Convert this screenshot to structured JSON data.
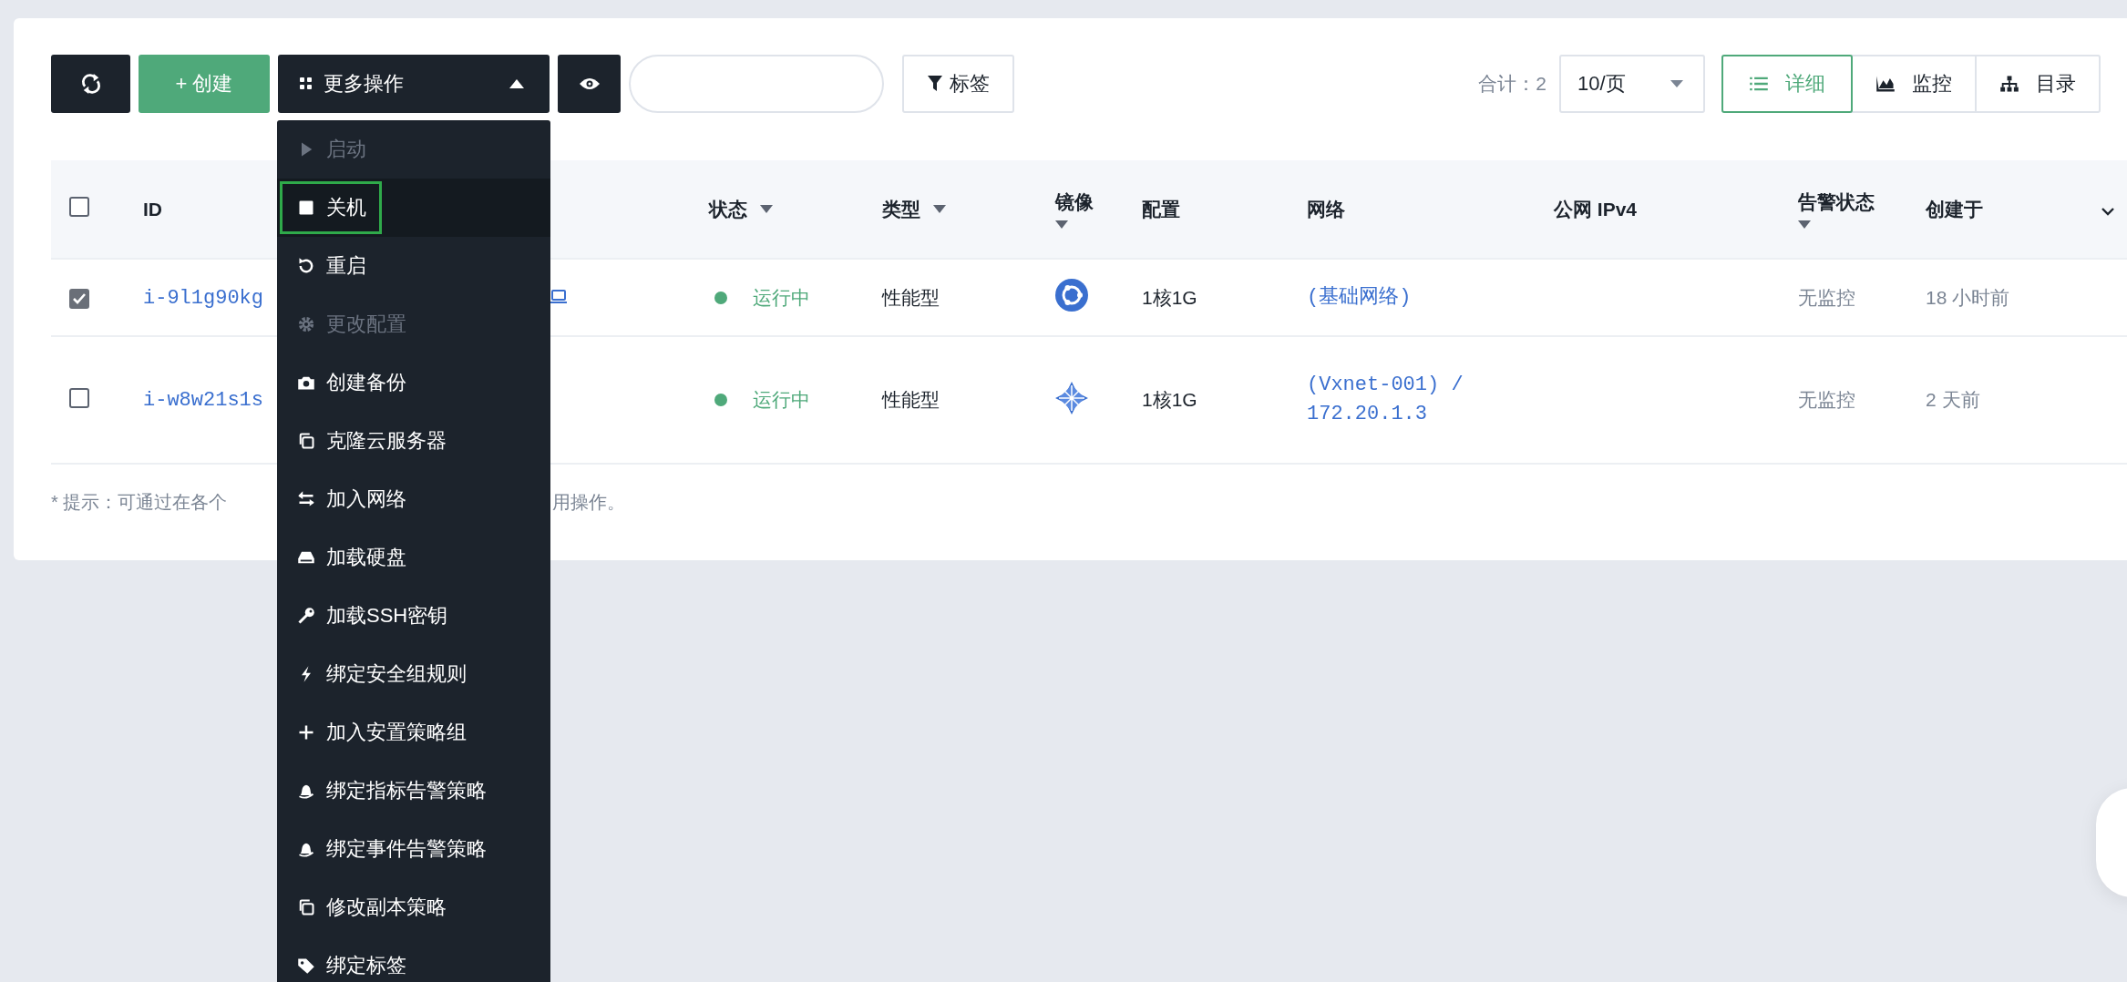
{
  "toolbar": {
    "create_button": "+ 创建",
    "more_button": {
      "label": "更多操作",
      "expanded": true
    },
    "tag_button": "标签",
    "total": "合计：2",
    "page_size": "10/页",
    "views": [
      {
        "label": "详细",
        "kind": "list",
        "selected": true
      },
      {
        "label": "监控",
        "kind": "area",
        "selected": false
      },
      {
        "label": "目录",
        "kind": "tree",
        "selected": false
      }
    ]
  },
  "table": {
    "select_all": {
      "checked": false
    },
    "columns": [
      {
        "label": "ID",
        "filter": false
      },
      {
        "label": "状态",
        "filter": true
      },
      {
        "label": "类型",
        "filter": true
      },
      {
        "label": "镜像",
        "filter": true
      },
      {
        "label": "配置",
        "filter": false
      },
      {
        "label": "网络",
        "filter": false
      },
      {
        "label": "公网 IPv4",
        "filter": false
      },
      {
        "label": "告警状态",
        "filter": true
      },
      {
        "label": "创建于",
        "filter": false
      }
    ],
    "rows": [
      {
        "checked": true,
        "id": "i-9l1g90kg",
        "console_icon": true,
        "status": "运行中",
        "type": "性能型",
        "image": {
          "kind": "ring"
        },
        "config": "1核1G",
        "network": "(基础网络)",
        "alarm": "无监控",
        "created": "18 小时前"
      },
      {
        "checked": false,
        "id": "i-w8w21s1s",
        "console_icon": false,
        "status": "运行中",
        "type": "性能型",
        "image": {
          "kind": "flake"
        },
        "config": "1核1G",
        "network": "(Vxnet-001) / 172.20.1.3",
        "alarm": "无监控",
        "created": "2 天前"
      }
    ]
  },
  "hint": [
    "* 提示：可通过在各个",
    "用操作。"
  ],
  "menu": {
    "items": [
      {
        "label": "启动",
        "kind": "play",
        "disabled": true,
        "selected": false
      },
      {
        "label": "关机",
        "kind": "stop",
        "disabled": false,
        "selected": true
      },
      {
        "label": "重启",
        "kind": "restart",
        "disabled": false,
        "selected": false
      },
      {
        "label": "更改配置",
        "kind": "gear",
        "disabled": true,
        "selected": false
      },
      {
        "label": "创建备份",
        "kind": "camera",
        "disabled": false,
        "selected": false
      },
      {
        "label": "克隆云服务器",
        "kind": "copy",
        "disabled": false,
        "selected": false
      },
      {
        "label": "加入网络",
        "kind": "swap",
        "disabled": false,
        "selected": false
      },
      {
        "label": "加载硬盘",
        "kind": "drive",
        "disabled": false,
        "selected": false
      },
      {
        "label": "加载SSH密钥",
        "kind": "key",
        "disabled": false,
        "selected": false
      },
      {
        "label": "绑定安全组规则",
        "kind": "bolt",
        "disabled": false,
        "selected": false
      },
      {
        "label": "加入安置策略组",
        "kind": "plus",
        "disabled": false,
        "selected": false
      },
      {
        "label": "绑定指标告警策略",
        "kind": "bell",
        "disabled": false,
        "selected": false
      },
      {
        "label": "绑定事件告警策略",
        "kind": "bell",
        "disabled": false,
        "selected": false
      },
      {
        "label": "修改副本策略",
        "kind": "copy",
        "disabled": false,
        "selected": false
      },
      {
        "label": "绑定标签",
        "kind": "tag",
        "disabled": false,
        "selected": false
      }
    ]
  }
}
